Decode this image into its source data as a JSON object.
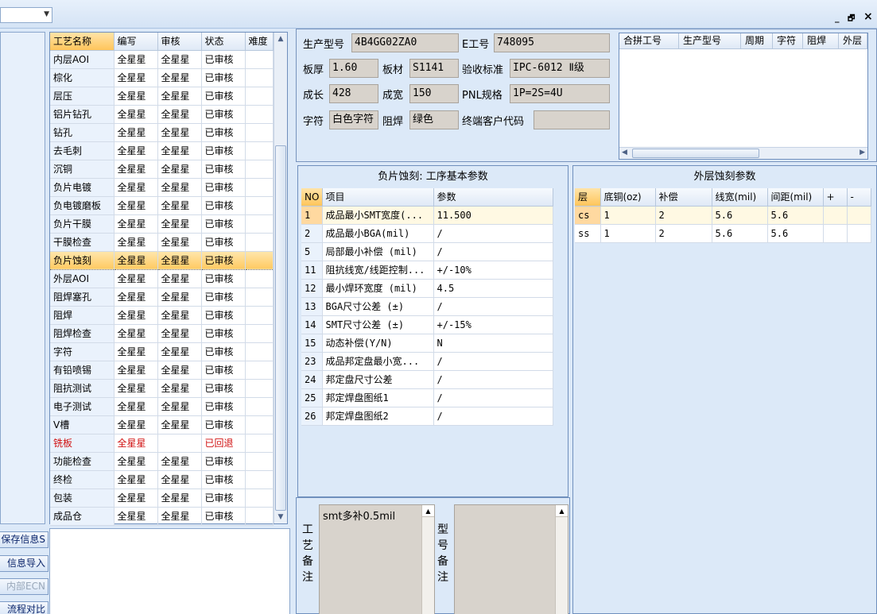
{
  "window": {
    "minimize": "_",
    "restore": "🗗",
    "close": "×"
  },
  "left_buttons": [
    {
      "label": "保存信息S",
      "enabled": true
    },
    {
      "label": "信息导入",
      "enabled": true
    },
    {
      "label": "内部ECN",
      "enabled": false
    },
    {
      "label": "流程对比",
      "enabled": true
    }
  ],
  "process_table": {
    "columns": [
      "工艺名称",
      "编写",
      "审核",
      "状态",
      "难度"
    ],
    "rows": [
      [
        "内层AOI",
        "全星星",
        "全星星",
        "已审核",
        ""
      ],
      [
        "棕化",
        "全星星",
        "全星星",
        "已审核",
        ""
      ],
      [
        "层压",
        "全星星",
        "全星星",
        "已审核",
        ""
      ],
      [
        "铝片钻孔",
        "全星星",
        "全星星",
        "已审核",
        ""
      ],
      [
        "钻孔",
        "全星星",
        "全星星",
        "已审核",
        ""
      ],
      [
        "去毛刺",
        "全星星",
        "全星星",
        "已审核",
        ""
      ],
      [
        "沉铜",
        "全星星",
        "全星星",
        "已审核",
        ""
      ],
      [
        "负片电镀",
        "全星星",
        "全星星",
        "已审核",
        ""
      ],
      [
        "负电镀磨板",
        "全星星",
        "全星星",
        "已审核",
        ""
      ],
      [
        "负片干膜",
        "全星星",
        "全星星",
        "已审核",
        ""
      ],
      [
        "干膜检查",
        "全星星",
        "全星星",
        "已审核",
        ""
      ],
      [
        "负片蚀刻",
        "全星星",
        "全星星",
        "已审核",
        ""
      ],
      [
        "外层AOI",
        "全星星",
        "全星星",
        "已审核",
        ""
      ],
      [
        "阻焊塞孔",
        "全星星",
        "全星星",
        "已审核",
        ""
      ],
      [
        "阻焊",
        "全星星",
        "全星星",
        "已审核",
        ""
      ],
      [
        "阻焊检查",
        "全星星",
        "全星星",
        "已审核",
        ""
      ],
      [
        "字符",
        "全星星",
        "全星星",
        "已审核",
        ""
      ],
      [
        "有铅喷锡",
        "全星星",
        "全星星",
        "已审核",
        ""
      ],
      [
        "阻抗测试",
        "全星星",
        "全星星",
        "已审核",
        ""
      ],
      [
        "电子测试",
        "全星星",
        "全星星",
        "已审核",
        ""
      ],
      [
        "V槽",
        "全星星",
        "全星星",
        "已审核",
        ""
      ],
      [
        "铣板",
        "全星星",
        "",
        "已回退",
        ""
      ],
      [
        "功能检查",
        "全星星",
        "全星星",
        "已审核",
        ""
      ],
      [
        "终检",
        "全星星",
        "全星星",
        "已审核",
        ""
      ],
      [
        "包装",
        "全星星",
        "全星星",
        "已审核",
        ""
      ],
      [
        "成品仓",
        "全星星",
        "全星星",
        "已审核",
        ""
      ]
    ],
    "selected_index": 11,
    "rejected_index": 21
  },
  "info": {
    "model_label": "生产型号",
    "model_value": "4B4GG02ZA0",
    "eno_label": "E工号",
    "eno_value": "748095",
    "thickness_label": "板厚",
    "thickness_value": "1.60",
    "material_label": "板材",
    "material_value": "S1141",
    "standard_label": "验收标准",
    "standard_value": "IPC-6012 Ⅱ级",
    "length_label": "成长",
    "length_value": "428",
    "width_label": "成宽",
    "width_value": "150",
    "pnl_label": "PNL规格",
    "pnl_value": "1P=2S=4U",
    "char_label": "字符",
    "char_value": "白色字符",
    "mask_label": "阻焊",
    "mask_value": "绿色",
    "customer_label": "终端客户代码",
    "customer_value": ""
  },
  "merge_grid": {
    "columns": [
      "合拼工号",
      "生产型号",
      "周期",
      "字符",
      "阻焊",
      "外层"
    ]
  },
  "param_panel": {
    "title": "负片蚀刻: 工序基本参数",
    "columns": [
      "NO",
      "项目",
      "参数"
    ],
    "rows": [
      [
        "1",
        "成品最小SMT宽度(...",
        "11.500"
      ],
      [
        "2",
        "成品最小BGA(mil)",
        "/"
      ],
      [
        "5",
        "局部最小补偿 (mil)",
        "/"
      ],
      [
        "11",
        "阻抗线宽/线距控制...",
        "+/-10%"
      ],
      [
        "12",
        "最小焊环宽度 (mil)",
        "4.5"
      ],
      [
        "13",
        "BGA尺寸公差 (±)",
        "/"
      ],
      [
        "14",
        "SMT尺寸公差 (±)",
        "+/-15%"
      ],
      [
        "15",
        "动态补偿(Y/N)",
        "N"
      ],
      [
        "23",
        "成品邦定盘最小宽...",
        "/"
      ],
      [
        "24",
        "邦定盘尺寸公差",
        "/"
      ],
      [
        "25",
        "邦定焊盘图纸1",
        "/"
      ],
      [
        "26",
        "邦定焊盘图纸2",
        "/"
      ]
    ]
  },
  "outer_panel": {
    "title": "外层蚀刻参数",
    "columns": [
      "层",
      "底铜(oz)",
      "补偿",
      "线宽(mil)",
      "间距(mil)",
      "+",
      "-"
    ],
    "rows": [
      [
        "cs",
        "1",
        "2",
        "5.6",
        "5.6",
        "",
        ""
      ],
      [
        "ss",
        "1",
        "2",
        "5.6",
        "5.6",
        "",
        ""
      ]
    ]
  },
  "remarks": {
    "process_label": "工艺备注",
    "process_text": "smt多补0.5mil",
    "model_label": "型号备注",
    "model_text": ""
  }
}
